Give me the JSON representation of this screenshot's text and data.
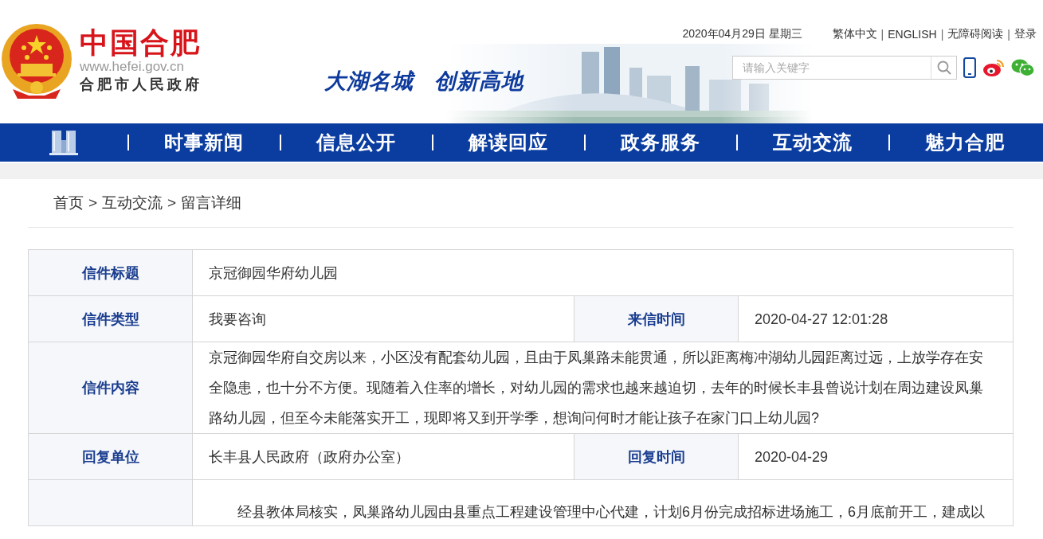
{
  "header": {
    "logo": {
      "title": "中国合肥",
      "url": "www.hefei.gov.cn",
      "subtitle": "合肥市人民政府"
    },
    "slogan": [
      "大湖名城",
      "创新高地"
    ],
    "date": "2020年04月29日 星期三",
    "links": [
      "繁体中文",
      "ENGLISH",
      "无障碍阅读",
      "登录"
    ],
    "link_separator": "|",
    "search": {
      "placeholder": "请输入关键字"
    }
  },
  "nav": {
    "items": [
      {
        "label": "时事新闻"
      },
      {
        "label": "信息公开"
      },
      {
        "label": "解读回应"
      },
      {
        "label": "政务服务"
      },
      {
        "label": "互动交流"
      },
      {
        "label": "魅力合肥"
      }
    ]
  },
  "breadcrumb": {
    "items": [
      "首页",
      "互动交流",
      "留言详细"
    ],
    "separator": ">"
  },
  "letter": {
    "rows": [
      {
        "kind": "single",
        "fields": [
          {
            "label": "信件标题",
            "value": "京冠御园华府幼儿园"
          }
        ]
      },
      {
        "kind": "double",
        "fields": [
          {
            "label": "信件类型",
            "value": "我要咨询"
          },
          {
            "label": "来信时间",
            "value": "2020-04-27 12:01:28"
          }
        ]
      },
      {
        "kind": "single",
        "fields": [
          {
            "label": "信件内容",
            "value": "京冠御园华府自交房以来，小区没有配套幼儿园，且由于凤巢路未能贯通，所以距离梅冲湖幼儿园距离过远，上放学存在安全隐患，也十分不方便。现随着入住率的增长，对幼儿园的需求也越来越迫切，去年的时候长丰县曾说计划在周边建设凤巢路幼儿园，但至今未能落实开工，现即将又到开学季，想询问何时才能让孩子在家门口上幼儿园?"
          }
        ]
      },
      {
        "kind": "double",
        "fields": [
          {
            "label": "回复单位",
            "value": "长丰县人民政府（政府办公室）"
          },
          {
            "label": "回复时间",
            "value": "2020-04-29"
          }
        ]
      },
      {
        "kind": "indented",
        "fields": [
          {
            "value": "经县教体局核实，凤巢路幼儿园由县重点工程建设管理中心代建，计划6月份完成招标进场施工，6月底前开工，建成以"
          }
        ]
      }
    ]
  }
}
